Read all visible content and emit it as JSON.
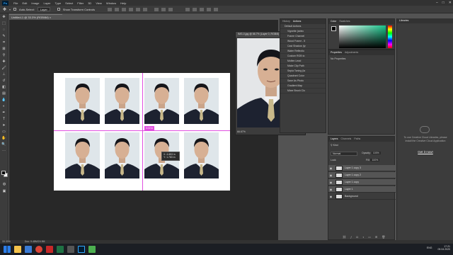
{
  "menubar": {
    "logo": "Ps",
    "items": [
      "File",
      "Edit",
      "Image",
      "Layer",
      "Type",
      "Select",
      "Filter",
      "3D",
      "View",
      "Window",
      "Help"
    ],
    "window_controls": [
      "–",
      "□",
      "✕"
    ]
  },
  "options_bar": {
    "auto_select_label": "Auto-Select:",
    "auto_select_target": "Layer",
    "transform_controls_label": "Show Transform Controls"
  },
  "document": {
    "tab_title": "Untitled-1 @ 33.3% (RGB/8#) ×",
    "guide_tag": "3.02 in",
    "tooltip_x": "X: 4.653 in",
    "tooltip_y": "Y: 1.783 in"
  },
  "floating_window": {
    "title": "IMG-0.jpg @ 66.7% (Layer 0, RGB/8)",
    "status": "66.67%"
  },
  "history_panel": {
    "tabs": [
      "History",
      "Actions"
    ],
    "items": [
      "Default Actions",
      "Vignette (selec",
      "Frame Channel",
      "Wood Frame - 5",
      "Cast Shadow (ty",
      "Water Reflectio",
      "Custom RGB to",
      "Molten Lead",
      "Make Clip Path",
      "Sepia Toning (la",
      "Quadrant Color",
      "Save As Photo",
      "Gradient Map",
      "Mixer Brush Clo"
    ]
  },
  "color_panel": {
    "tabs": [
      "Color",
      "Swatches"
    ]
  },
  "properties_panel": {
    "tabs": [
      "Properties",
      "Adjustments"
    ],
    "empty_label": "No Properties"
  },
  "libraries_panel": {
    "tab": "Libraries",
    "message": "To use Creative Cloud Libraries, please install the Creative Cloud Application",
    "link": "Get it now!"
  },
  "layers_panel": {
    "tabs": [
      "Layers",
      "Channels",
      "Paths"
    ],
    "kind_label": "Kind",
    "blend_mode": "Normal",
    "opacity_label": "Opacity:",
    "opacity": "100%",
    "lock_label": "Lock:",
    "fill_label": "Fill:",
    "fill": "100%",
    "layers": [
      {
        "name": "Layer 1 copy 3",
        "selected": true
      },
      {
        "name": "Layer 1 copy 2",
        "selected": true
      },
      {
        "name": "Layer 1 copy",
        "selected": true
      },
      {
        "name": "Layer 1",
        "selected": true
      },
      {
        "name": "Background",
        "selected": false
      }
    ]
  },
  "status_bar": {
    "zoom": "33.33%",
    "doc_info": "Doc: 9.48M/24.9M"
  },
  "taskbar": {
    "language": "ENG",
    "time": "17:21",
    "date": "09.04.2020"
  },
  "colors": {
    "ps_blue": "#31a8ff",
    "guide": "#e04fe0",
    "panel": "#3c3c3c",
    "canvas_bg": "#282828"
  }
}
